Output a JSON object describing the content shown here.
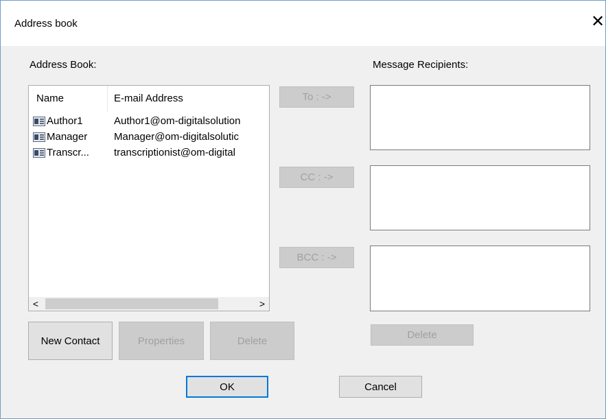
{
  "window": {
    "title": "Address book",
    "close_glyph": "✕"
  },
  "address_book": {
    "label": "Address Book:",
    "columns": [
      "Name",
      "E-mail Address"
    ],
    "rows": [
      {
        "name": "Author1",
        "email": "Author1@om-digitalsolution"
      },
      {
        "name": "Manager",
        "email": "Manager@om-digitalsolutic"
      },
      {
        "name": "Transcr...",
        "email": "transcriptionist@om-digital"
      }
    ],
    "contact_icon": "contact-card-icon",
    "scroll_left": "<",
    "scroll_right": ">"
  },
  "recipients": {
    "label": "Message Recipients:"
  },
  "buttons": {
    "to": "To : ->",
    "cc": "CC : ->",
    "bcc": "BCC : ->",
    "new_contact": "New Contact",
    "properties": "Properties",
    "delete": "Delete",
    "recipients_delete": "Delete",
    "ok": "OK",
    "cancel": "Cancel"
  }
}
